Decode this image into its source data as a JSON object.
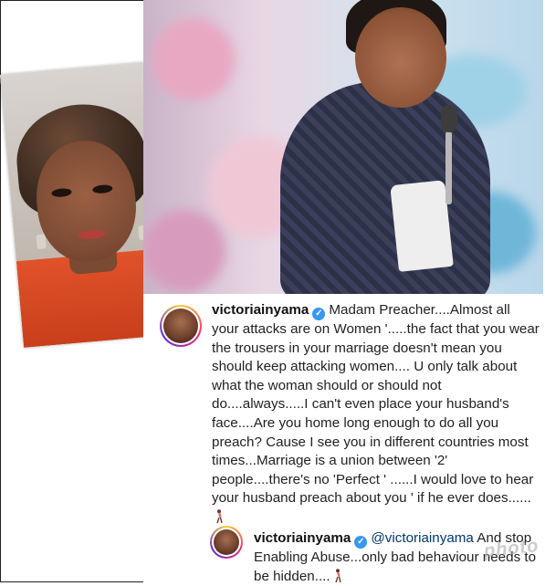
{
  "comments": [
    {
      "username": "victoriainyama",
      "text": "Madam Preacher....Almost all your attacks are on Women '.....the fact that you wear the trousers in your marriage doesn't mean you should keep attacking women.... U only talk about what the woman should or should not do....always.....I can't even place your husband's face....Are you home long enough to do all you preach? Cause I see you in different countries most times...Marriage is a union between '2' people....there's no 'Perfect ' ......I would love to hear your husband preach about you ' if he ever does......",
      "emoji_icon": "woman-walking-icon"
    },
    {
      "username": "victoriainyama",
      "mention": "@victoriainyama",
      "text": "And stop Enabling Abuse...only bad behaviour needs to be hidden....",
      "emoji_icon": "woman-walking-icon"
    }
  ],
  "watermark": "photo",
  "colors": {
    "verified": "#3897f0",
    "mention": "#00376b",
    "sweater": "#e0522a"
  }
}
